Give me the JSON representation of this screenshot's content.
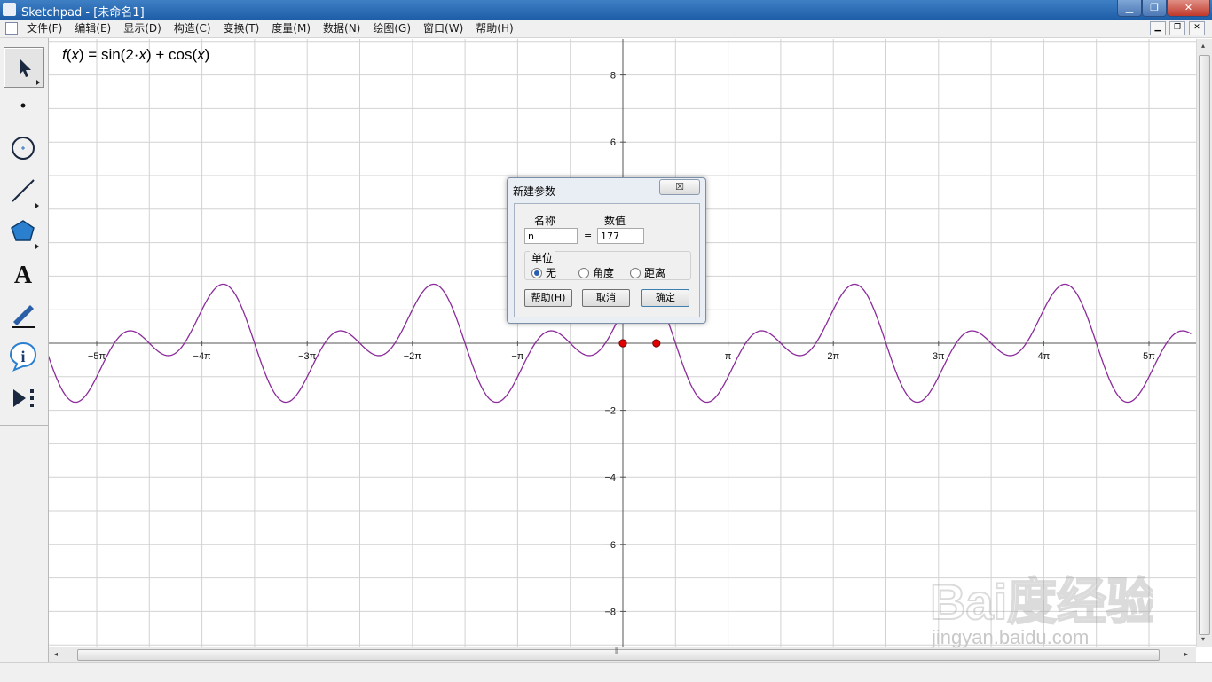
{
  "window": {
    "title": "Sketchpad  - [未命名1]",
    "minimize_glyph": "▁",
    "maximize_glyph": "❐",
    "close_glyph": "✕"
  },
  "menubar": {
    "items": [
      "文件(F)",
      "编辑(E)",
      "显示(D)",
      "构造(C)",
      "变换(T)",
      "度量(M)",
      "数据(N)",
      "绘图(G)",
      "窗口(W)",
      "帮助(H)"
    ],
    "doc_controls": [
      "▁",
      "❐",
      "✕"
    ]
  },
  "toolbox": {
    "tools": [
      {
        "name": "arrow-tool",
        "icon": "arrow-pointer-icon",
        "active": true
      },
      {
        "name": "point-tool",
        "icon": "point-icon"
      },
      {
        "name": "compass-tool",
        "icon": "circle-icon"
      },
      {
        "name": "straightedge-tool",
        "icon": "segment-icon"
      },
      {
        "name": "polygon-tool",
        "icon": "polygon-icon"
      },
      {
        "name": "text-tool",
        "icon": "text-a-icon"
      },
      {
        "name": "marker-tool",
        "icon": "pen-icon"
      },
      {
        "name": "information-tool",
        "icon": "info-icon"
      },
      {
        "name": "custom-tool",
        "icon": "play-menu-icon"
      }
    ]
  },
  "function_label": "f(x) = sin(2·x) + cos(x)",
  "chart_data": {
    "type": "line",
    "function": "sin(2x) + cos(x)",
    "x_range_pi": [
      -5.5,
      5.4
    ],
    "ylim": [
      -9,
      9
    ],
    "x_ticks": [
      "−5π",
      "−4π",
      "−3π",
      "−2π",
      "−π",
      "π",
      "2π",
      "3π",
      "4π",
      "5π"
    ],
    "x_tick_values_pi": [
      -5,
      -4,
      -3,
      -2,
      -1,
      1,
      2,
      3,
      4,
      5
    ],
    "y_ticks": [
      "8",
      "6",
      "−2",
      "−4",
      "−6",
      "−8"
    ],
    "y_tick_values": [
      8,
      6,
      -2,
      -4,
      -6,
      -8
    ],
    "points": [
      {
        "x": 0,
        "y": 0
      },
      {
        "x": 1,
        "y": 0
      }
    ],
    "grid": true,
    "curve_color": "#8b2a9b",
    "point_color": "#e00000"
  },
  "dialog": {
    "title": "新建参数",
    "close_glyph": "☒",
    "name_label": "名称",
    "value_label": "数值",
    "name_value": "n",
    "equals": "=",
    "value_value": "177",
    "units_label": "单位",
    "units": [
      {
        "label": "无",
        "selected": true
      },
      {
        "label": "角度",
        "selected": false
      },
      {
        "label": "距离",
        "selected": false
      }
    ],
    "help_button": "帮助(H)",
    "cancel_button": "取消",
    "ok_button": "确定"
  },
  "scrollbars": {
    "left_arrow": "◂",
    "right_arrow": "▸",
    "up_arrow": "▴",
    "down_arrow": "▾",
    "grip": "⦀"
  },
  "watermark": {
    "main": "Bai度经验",
    "sub": "jingyan.baidu.com"
  }
}
